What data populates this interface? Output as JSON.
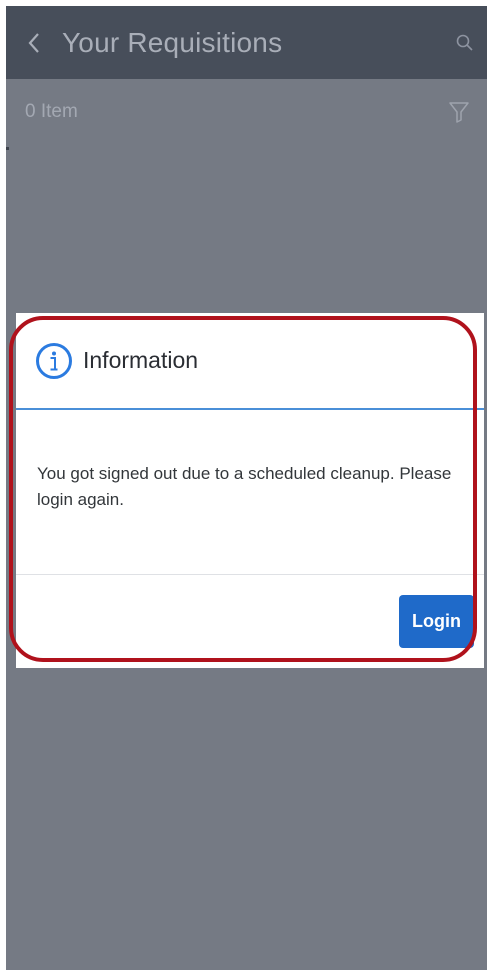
{
  "header": {
    "title": "Your Requisitions",
    "back_icon": "chevron-left-icon",
    "search_icon": "search-icon"
  },
  "list": {
    "count_label": "0 Item",
    "filter_icon": "filter-icon"
  },
  "dialog": {
    "icon": "info-icon",
    "title": "Information",
    "message": "You got signed out due to a scheduled cleanup. Please login again.",
    "button_label": "Login"
  },
  "colors": {
    "overlay_bg": "#757a84",
    "header_bg": "#474e5a",
    "accent": "#1f6ac9",
    "highlight": "#b0121c"
  }
}
